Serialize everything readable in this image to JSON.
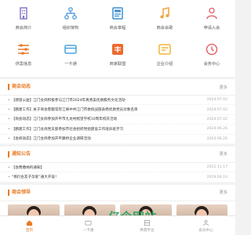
{
  "grid_row1": [
    {
      "label": "商会简介",
      "icon": "building-icon",
      "color": "#8a78c8"
    },
    {
      "label": "组织架构",
      "icon": "org-chart-icon",
      "color": "#5aa0dc"
    },
    {
      "label": "商会章程",
      "icon": "document-icon",
      "color": "#3f8fcf"
    },
    {
      "label": "商会会歌",
      "icon": "music-icon",
      "color": "#f0a23a"
    },
    {
      "label": "申请入会",
      "icon": "add-user-icon",
      "color": "#e36f78"
    }
  ],
  "grid_row2": [
    {
      "label": "供需信息",
      "icon": "supply-demand-icon",
      "color": "#ea7a2b"
    },
    {
      "label": "一卡通",
      "icon": "card-icon",
      "color": "#4aa6d9"
    },
    {
      "label": "商家联盟",
      "icon": "shop-alliance-icon",
      "color": "#ee6a2e"
    },
    {
      "label": "企业介绍",
      "icon": "company-icon",
      "color": "#f2b53a"
    },
    {
      "label": "会务中心",
      "icon": "meeting-center-icon",
      "color": "#e3676f"
    }
  ],
  "news": {
    "title": "商会动态",
    "more": "更多",
    "items": [
      {
        "text": "【感恩公益】江门女商积极参与江门市2024年真善美优质服务文化活动",
        "date": "2024.07.02"
      },
      {
        "text": "【鹏建工作】关于商会客服常年江峡中共江门市委统战部表扬优质党员对象名单",
        "date": "2024.07.02"
      },
      {
        "text": "【商会动态】江门女商参加开平市九龙村梳望学校10周年校庆活动",
        "date": "2024.07.02"
      },
      {
        "text": "【鹏建工作】江门女商党支部参加市社会组织党组建设工作培训班学习",
        "date": "2024.06.26"
      },
      {
        "text": "【会商动态】江门女商参加开平藤桥企业调研活动",
        "date": "2024.06.26"
      }
    ]
  },
  "notice": {
    "title": "通知公告",
    "more": "更多",
    "items": [
      {
        "text": "【会费缴纳的通知】",
        "date": "2022.11.17"
      },
      {
        "text": "“捐衍古友子孕爱”通大开设！",
        "date": "2019.04.03"
      }
    ]
  },
  "leaders": {
    "title": "商会领导",
    "more": "更多"
  },
  "bottom_nav": [
    {
      "label": "首页",
      "icon": "home-icon",
      "active": true
    },
    {
      "label": "一卡通",
      "icon": "card-icon",
      "active": false
    },
    {
      "label": "供需平台",
      "icon": "platform-icon",
      "active": false
    },
    {
      "label": "会员中心",
      "icon": "user-icon",
      "active": false
    }
  ],
  "watermark": "亿企网站",
  "colors": {
    "accent": "#e97a24",
    "watermark": "#1aa05a"
  }
}
